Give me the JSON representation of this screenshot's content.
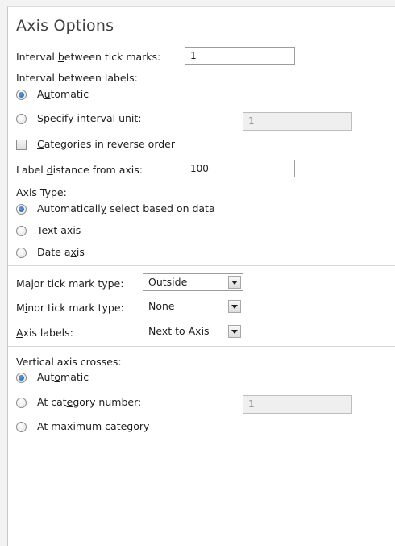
{
  "title": "Axis Options",
  "interval_tick_marks": {
    "pre": "Interval ",
    "u": "b",
    "post": "etween tick marks:",
    "value": "1"
  },
  "interval_labels_heading": "Interval between labels:",
  "interval_labels_automatic": {
    "pre": "A",
    "u": "u",
    "post": "tomatic"
  },
  "interval_labels_specify": {
    "pre": "",
    "u": "S",
    "post": "pecify interval unit:",
    "value": "1"
  },
  "reverse_order": {
    "pre": "",
    "u": "C",
    "post": "ategories in reverse order"
  },
  "label_distance": {
    "pre": "Label ",
    "u": "d",
    "post": "istance from axis:",
    "value": "100"
  },
  "axis_type_heading": "Axis Type:",
  "axis_type_auto": {
    "pre": "Automaticall",
    "u": "y",
    "post": " select based on data"
  },
  "axis_type_text": {
    "pre": "",
    "u": "T",
    "post": "ext axis"
  },
  "axis_type_date": {
    "pre": "Date a",
    "u": "x",
    "post": "is"
  },
  "major_tick": {
    "label": "Major tick mark type:",
    "value": "Outside"
  },
  "minor_tick": {
    "pre": "M",
    "u": "i",
    "post": "nor tick mark type:",
    "value": "None"
  },
  "axis_labels": {
    "pre": "",
    "u": "A",
    "post": "xis labels:",
    "value": "Next to Axis"
  },
  "crosses_heading": "Vertical axis crosses:",
  "crosses_auto": {
    "pre": "Aut",
    "u": "o",
    "post": "matic"
  },
  "crosses_category": {
    "pre": "At cat",
    "u": "e",
    "post": "gory number:",
    "value": "1"
  },
  "crosses_max": {
    "pre": "At maximum categ",
    "u": "o",
    "post": "ry"
  }
}
